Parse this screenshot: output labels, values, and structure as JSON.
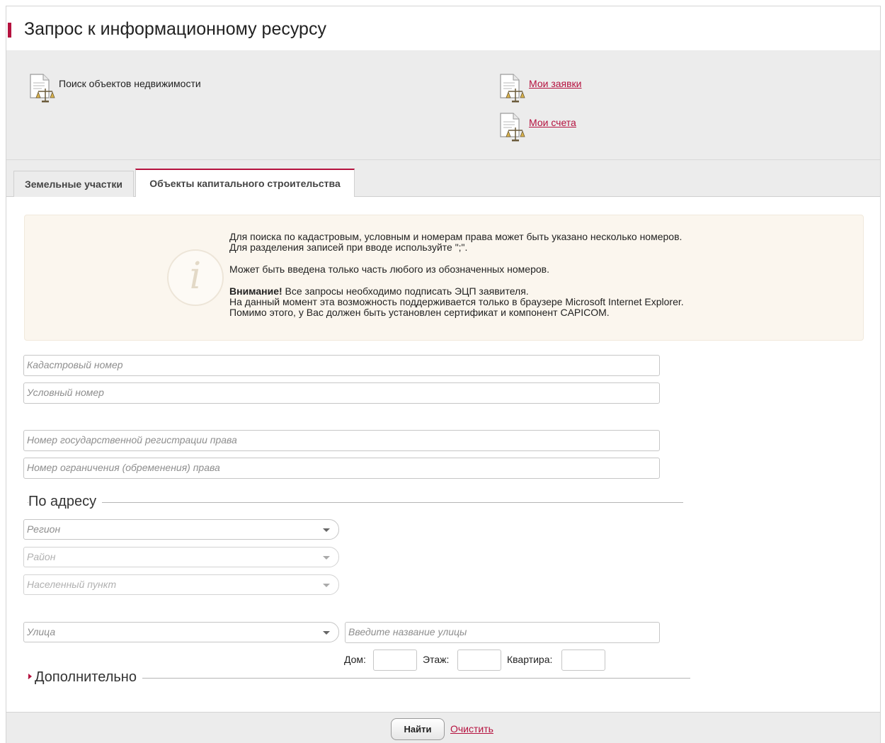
{
  "header": {
    "title": "Запрос к информационному ресурсу"
  },
  "links": {
    "search": "Поиск объектов недвижимости",
    "my_requests": "Мои заявки",
    "my_bills": "Мои счета"
  },
  "tabs": [
    {
      "label": "Земельные участки",
      "active": false
    },
    {
      "label": "Объекты капитального строительства",
      "active": true
    }
  ],
  "info": {
    "line1": "Для поиска по кадастровым, условным и номерам права может быть указано несколько номеров.",
    "line2": "Для разделения записей при вводе используйте \";\".",
    "line3": "Может быть введена только часть любого из обозначенных номеров.",
    "warning_bold": "Внимание!",
    "warning_rest": " Все запросы необходимо подписать ЭЦП заявителя.",
    "line5": "На данный момент эта возможность поддерживается только в браузере Microsoft Internet Explorer.",
    "line6": "Помимо этого, у Вас должен быть установлен сертификат и компонент CAPICOM."
  },
  "fields": {
    "cadastral": "Кадастровый номер",
    "conditional": "Условный номер",
    "state_reg": "Номер государственной регистрации права",
    "restriction": "Номер ограничения (обременения) права"
  },
  "address": {
    "title": "По адресу",
    "region": "Регион",
    "district": "Район",
    "locality": "Населенный пункт",
    "street": "Улица",
    "street_name": "Введите название улицы",
    "house": "Дом:",
    "floor": "Этаж:",
    "apartment": "Квартира:"
  },
  "extra": {
    "title": "Дополнительно"
  },
  "footer": {
    "find": "Найти",
    "clear": "Очистить"
  },
  "colors": {
    "accent": "#b5123f",
    "panel": "#ececec",
    "info_bg": "#fbf6ee"
  },
  "icons": [
    "document-scales-icon",
    "info-icon",
    "dropdown-caret-icon",
    "expand-triangle-icon"
  ]
}
